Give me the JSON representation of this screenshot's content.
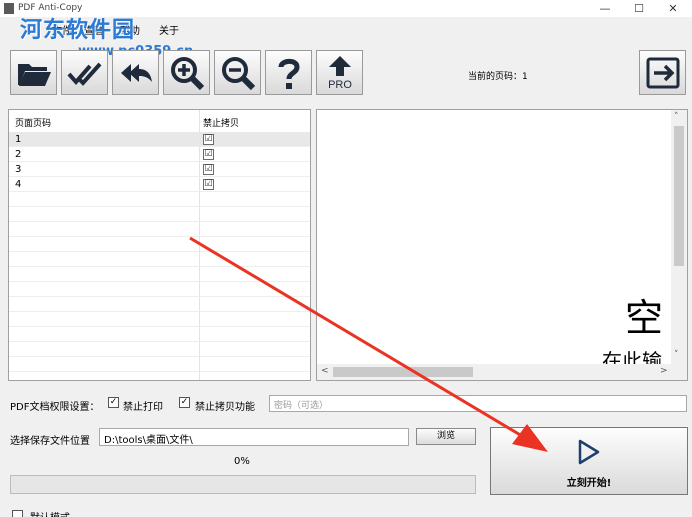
{
  "window": {
    "title": "PDF Anti-Copy",
    "minimize": "—",
    "maximize": "☐",
    "close": "✕"
  },
  "watermark": {
    "text": "河东软件园",
    "url": "www.pc0359.cn"
  },
  "menu": [
    "文件",
    "查看",
    "帮助",
    "关于"
  ],
  "toolbar": {
    "buttons": [
      "open-folder",
      "check-all",
      "uncheck-all",
      "zoom-in",
      "zoom-out",
      "help",
      "upgrade-pro"
    ],
    "pro_label": "PRO",
    "current_page_label": "当前的页码：1"
  },
  "table": {
    "headers": [
      "页面页码",
      "禁止拷贝"
    ],
    "rows": [
      {
        "page": "1",
        "checked": "☑"
      },
      {
        "page": "2",
        "checked": "☑"
      },
      {
        "page": "3",
        "checked": "☑"
      },
      {
        "page": "4",
        "checked": "☑"
      }
    ]
  },
  "preview": {
    "line1": "空",
    "line2": "在此输"
  },
  "permissions": {
    "label": "PDF文档权限设置：",
    "print_label": "禁止打印",
    "print_checked": "✓",
    "copy_label": "禁止拷贝功能",
    "copy_checked": "✓",
    "password_placeholder": "密码（可选）"
  },
  "save": {
    "label": "选择保存文件位置",
    "path": "D:\\tools\\桌面\\文件\\",
    "browse": "浏览"
  },
  "progress": {
    "percent_text": "0%",
    "value": 0
  },
  "start": {
    "label": "立刻开始!"
  },
  "mode": {
    "label": "默认模式"
  },
  "colors": {
    "arrow": "#ea3323",
    "watermark": "#2a7ad6",
    "icon_dark": "#1f2b3a"
  }
}
